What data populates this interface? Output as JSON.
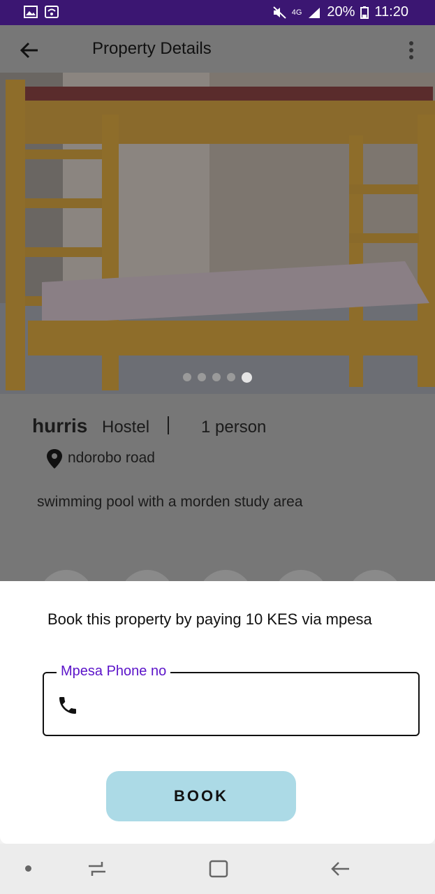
{
  "status_bar": {
    "network": "4G",
    "battery": "20%",
    "time": "11:20",
    "icons": [
      "image-icon",
      "wifi-hotspot-icon",
      "mute-icon",
      "signal-icon",
      "battery-icon"
    ]
  },
  "app_bar": {
    "title": "Property Details",
    "back_icon": "arrow-back-icon",
    "menu_icon": "more-vert-icon"
  },
  "gallery": {
    "image_description_icon": "bunk-bed-photo",
    "dot_count": 5,
    "active_index": 4
  },
  "property": {
    "name": "hurris",
    "type": "Hostel",
    "capacity": "1 person",
    "location": "ndorobo road",
    "description": "swimming pool with a morden study area"
  },
  "booking_sheet": {
    "message": "Book this property by paying 10 KES via mpesa",
    "phone_label": "Mpesa Phone no",
    "phone_value": "",
    "book_label": "BOOK"
  },
  "colors": {
    "status_bar": "#3b1672",
    "accent": "#5b13c9",
    "book_button": "#acdae6"
  }
}
